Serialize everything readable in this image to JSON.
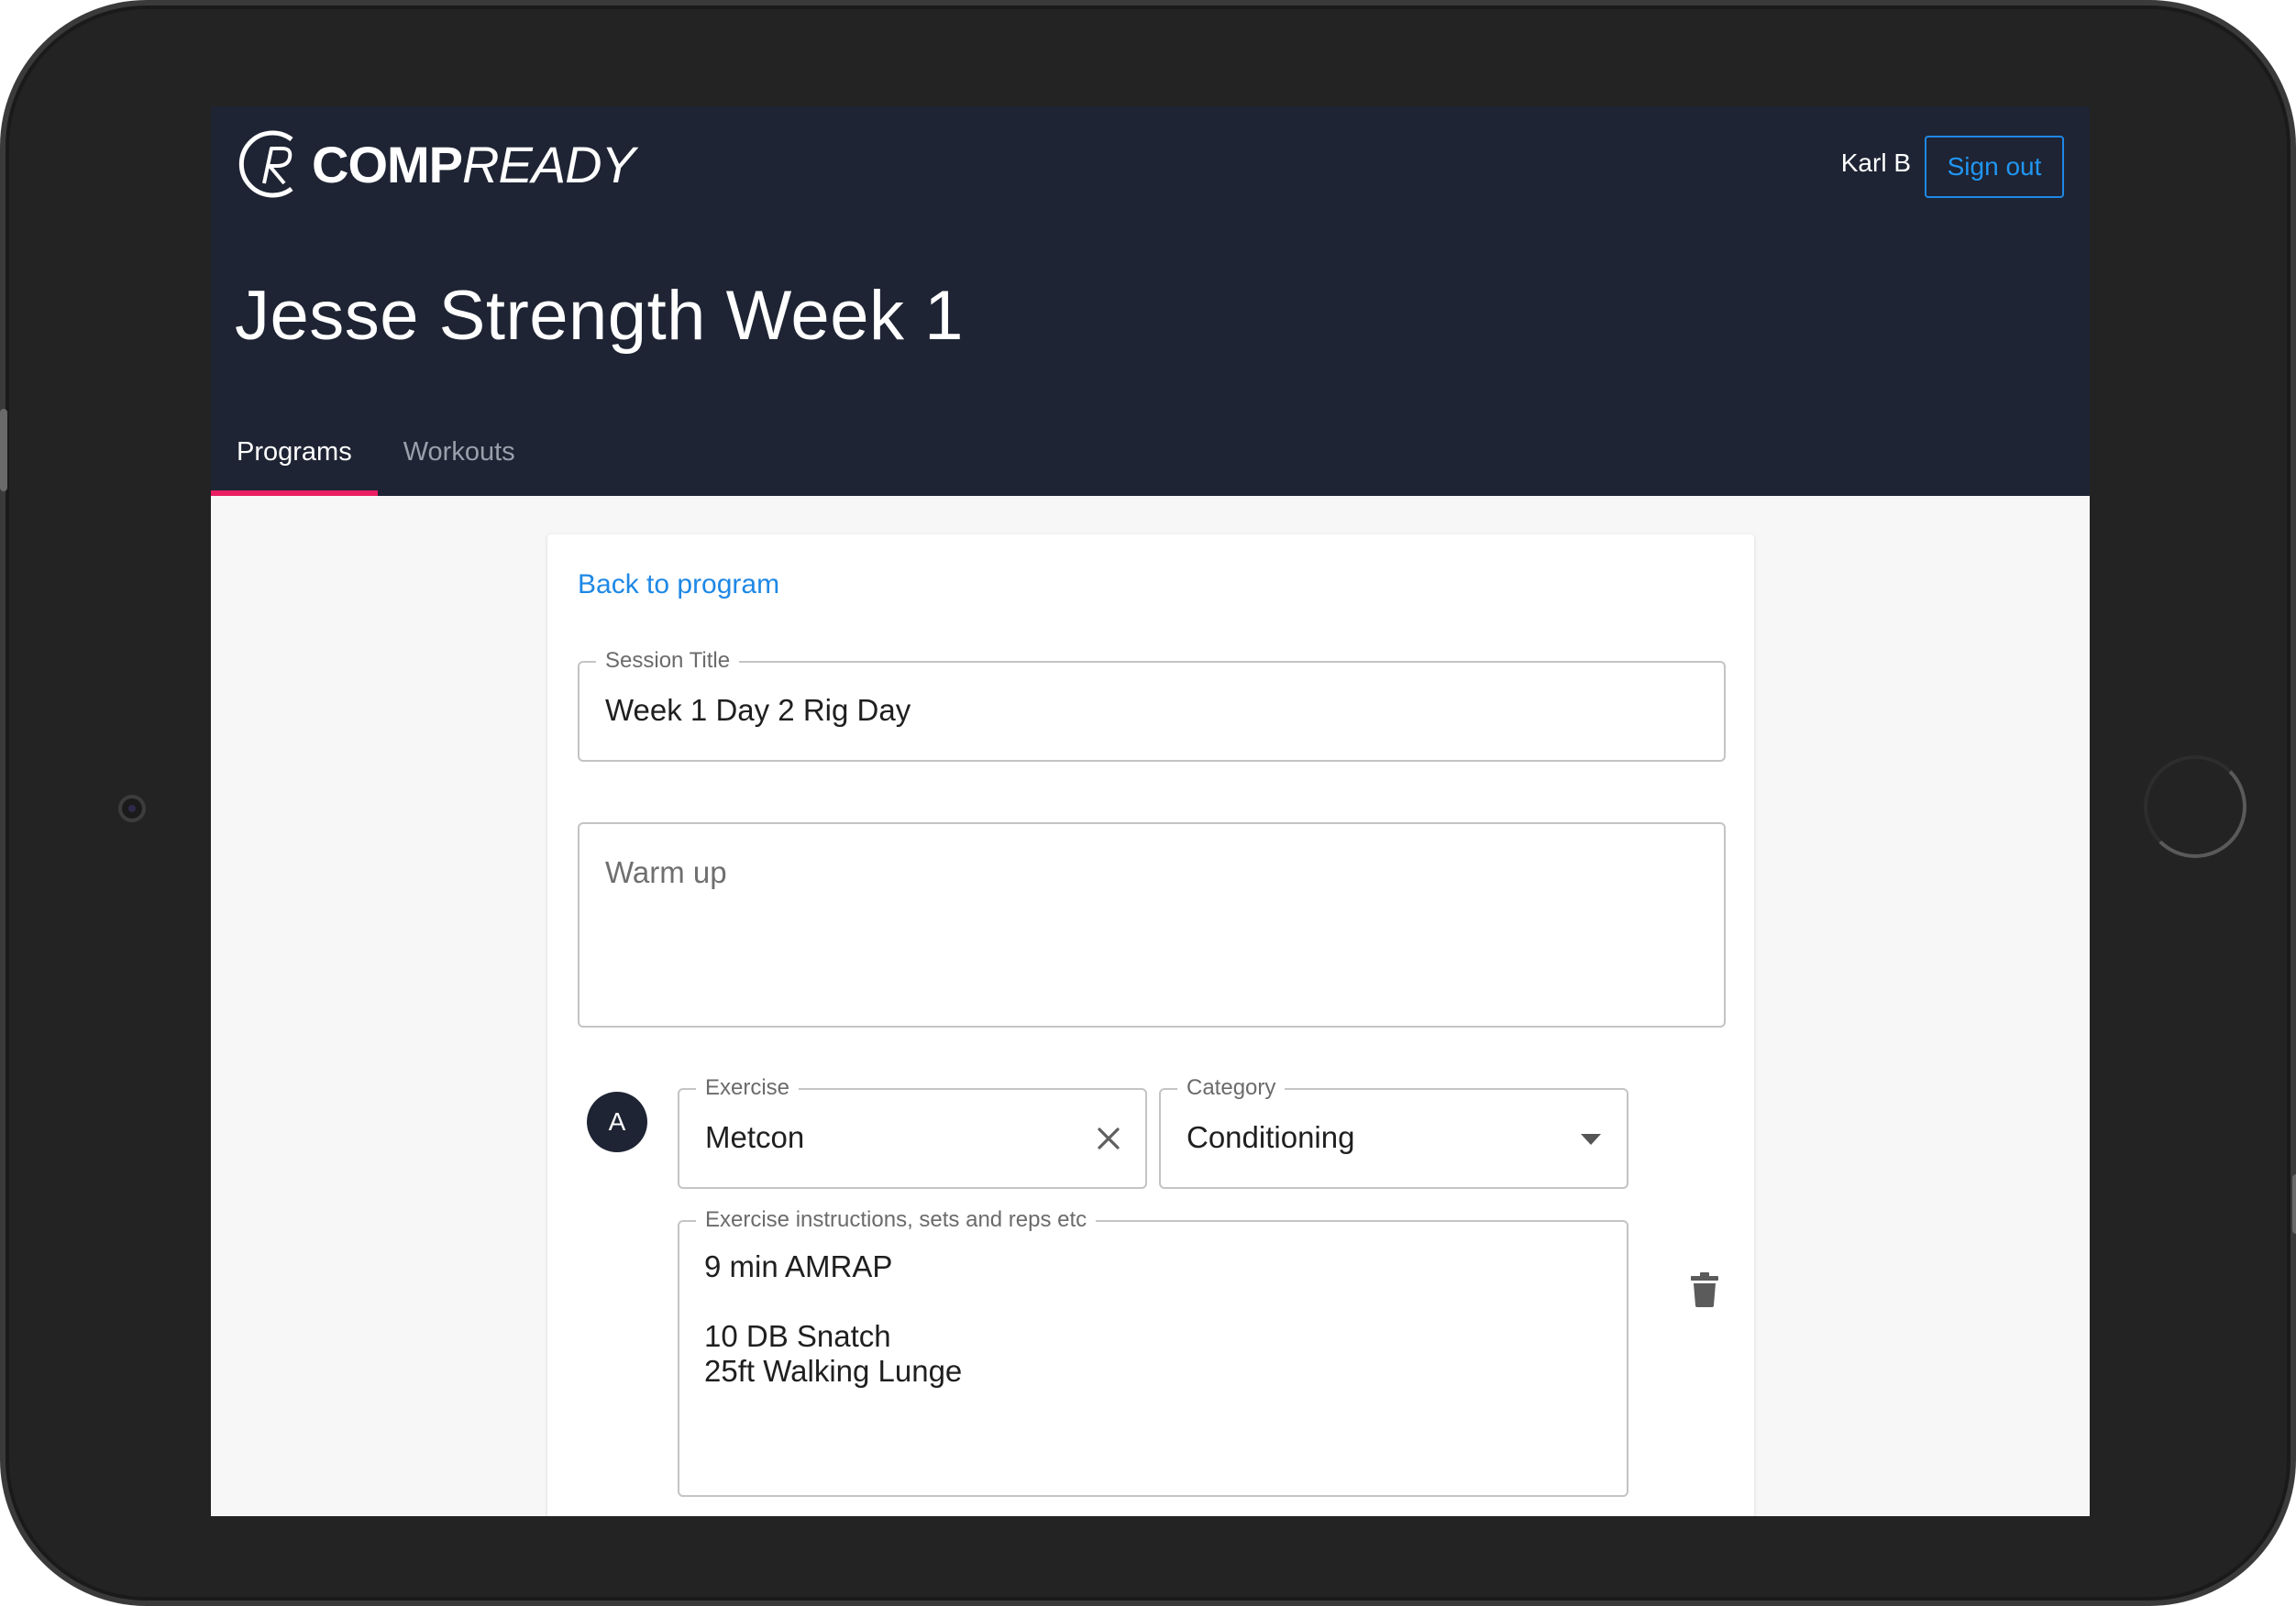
{
  "brand": {
    "logo_bold": "COMP",
    "logo_light": "READY"
  },
  "header": {
    "user_name": "Karl B",
    "signout_label": "Sign out",
    "page_title": "Jesse Strength Week 1"
  },
  "tabs": [
    {
      "label": "Programs",
      "active": true
    },
    {
      "label": "Workouts",
      "active": false
    }
  ],
  "card": {
    "back_link": "Back to program",
    "session_title": {
      "label": "Session Title",
      "value": "Week 1 Day 2 Rig Day"
    },
    "warm_up": {
      "placeholder": "Warm up",
      "value": ""
    },
    "exercise_block": {
      "badge": "A",
      "exercise": {
        "label": "Exercise",
        "value": "Metcon"
      },
      "category": {
        "label": "Category",
        "value": "Conditioning"
      },
      "instructions": {
        "label": "Exercise instructions, sets and reps etc",
        "value": "9 min AMRAP\n\n10 DB Snatch\n25ft Walking Lunge"
      }
    }
  },
  "colors": {
    "header_bg": "#1e2433",
    "accent": "#e91e63",
    "link": "#1e88e5"
  },
  "icons": [
    "clear-icon",
    "dropdown-arrow-icon",
    "trash-icon"
  ]
}
